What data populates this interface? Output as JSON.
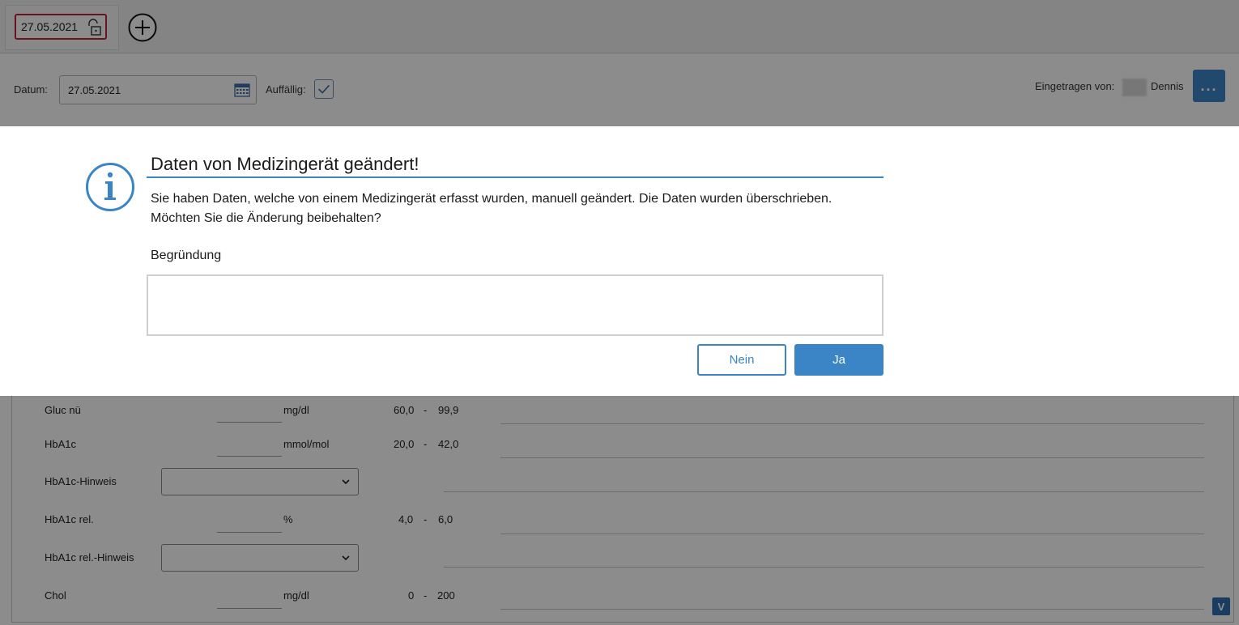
{
  "tabs": {
    "active_tab_date": "27.05.2021",
    "add_icon": "plus-circle-icon",
    "lock_icon": "unlock-icon"
  },
  "header": {
    "date_label": "Datum:",
    "date_value": "27.05.2021",
    "flag_label": "Auffällig:",
    "flag_checked": true,
    "entered_by_label": "Eingetragen von:",
    "entered_by_name": "Dennis",
    "more_label": "..."
  },
  "form": {
    "rows": [
      {
        "label": "Gluc nü",
        "unit": "mg/dl",
        "range_low": "60,0",
        "range_sep": "-",
        "range_high": "99,9"
      },
      {
        "label": "HbA1c",
        "unit": "mmol/mol",
        "range_low": "20,0",
        "range_sep": "-",
        "range_high": "42,0"
      },
      {
        "label": "HbA1c-Hinweis"
      },
      {
        "label": "HbA1c rel.",
        "unit": "%",
        "range_low": "4,0",
        "range_sep": "-",
        "range_high": "6,0"
      },
      {
        "label": "HbA1c rel.-Hinweis"
      },
      {
        "label": "Chol",
        "unit": "mg/dl",
        "range_low": "0",
        "range_sep": "-",
        "range_high": "200"
      }
    ],
    "scroll_down_label": "V"
  },
  "dialog": {
    "title": "Daten von Medizingerät geändert!",
    "message": "Sie haben Daten, welche von einem Medizingerät erfasst wurden, manuell geändert. Die Daten wurden überschrieben. Möchten Sie die Änderung beibehalten?",
    "reason_label": "Begründung",
    "reason_value": "",
    "no_label": "Nein",
    "yes_label": "Ja",
    "accent_color": "#3b85c6"
  }
}
